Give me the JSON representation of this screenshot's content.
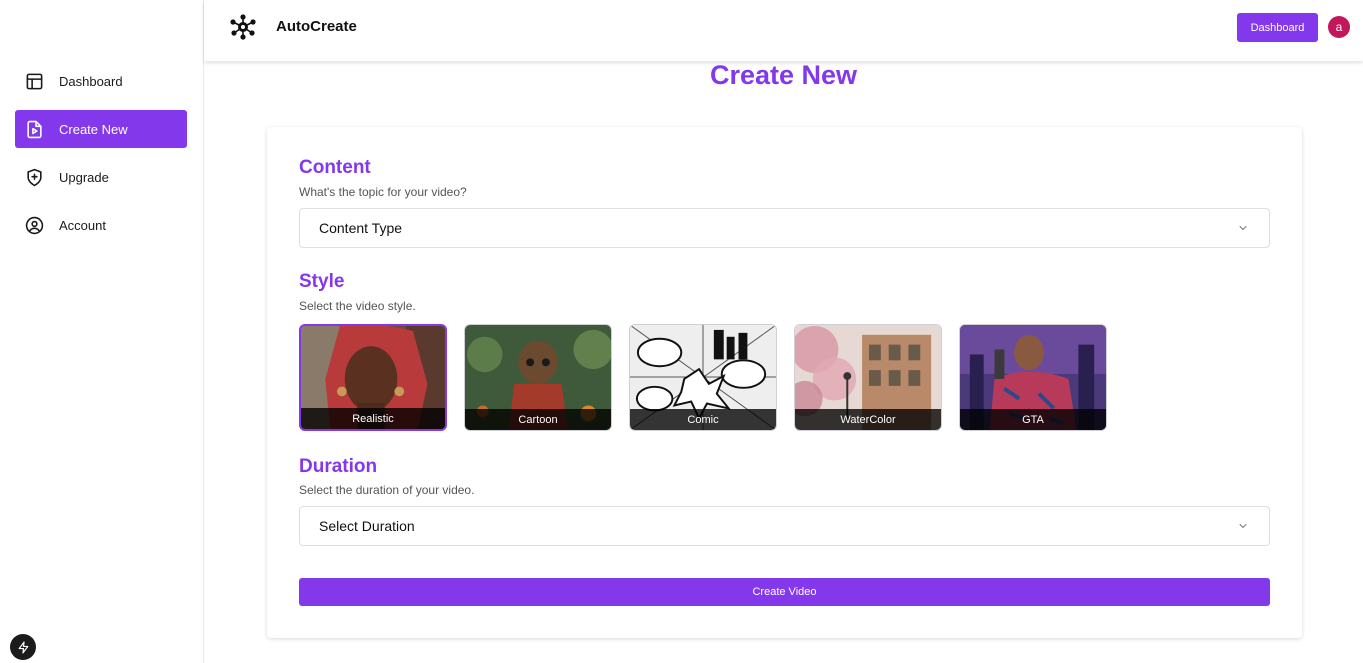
{
  "app": {
    "name": "AutoCreate"
  },
  "sidebar": {
    "items": [
      {
        "label": "Dashboard",
        "icon": "layout-icon",
        "active": false
      },
      {
        "label": "Create New",
        "icon": "file-video-icon",
        "active": true
      },
      {
        "label": "Upgrade",
        "icon": "shield-plus-icon",
        "active": false
      },
      {
        "label": "Account",
        "icon": "user-circle-icon",
        "active": false
      }
    ]
  },
  "header": {
    "dashboard_label": "Dashboard",
    "avatar_letter": "a"
  },
  "main": {
    "title": "Create New",
    "content": {
      "title": "Content",
      "subtitle": "What's the topic for your video?",
      "select_value": "Content Type"
    },
    "style": {
      "title": "Style",
      "subtitle": "Select the video style.",
      "options": [
        {
          "label": "Realistic",
          "selected": true
        },
        {
          "label": "Cartoon",
          "selected": false
        },
        {
          "label": "Comic",
          "selected": false
        },
        {
          "label": "WaterColor",
          "selected": false
        },
        {
          "label": "GTA",
          "selected": false
        }
      ]
    },
    "duration": {
      "title": "Duration",
      "subtitle": "Select the duration of your video.",
      "select_value": "Select Duration"
    },
    "create_button": "Create Video"
  },
  "colors": {
    "accent": "#8338ec",
    "avatar": "#c2185b"
  }
}
